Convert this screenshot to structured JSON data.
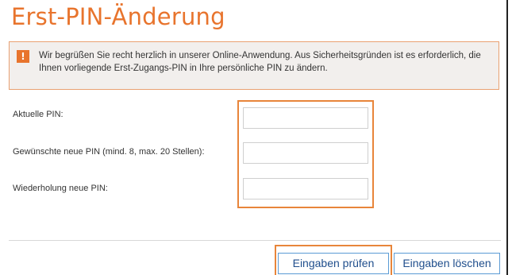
{
  "page": {
    "title": "Erst-PIN-Änderung"
  },
  "notice": {
    "icon": "warning-exclamation-icon",
    "icon_glyph": "!",
    "text": "Wir begrüßen Sie recht herzlich in unserer Online-Anwendung. Aus Sicherheitsgründen ist es erforderlich, die Ihnen vorliegende Erst-Zugangs-PIN in Ihre persönliche PIN zu ändern."
  },
  "form": {
    "current_pin_label": "Aktuelle PIN:",
    "new_pin_label": "Gewünschte neue PIN (mind. 8, max. 20 Stellen):",
    "repeat_pin_label": "Wiederholung neue PIN:",
    "current_pin_value": "",
    "new_pin_value": "",
    "repeat_pin_value": ""
  },
  "actions": {
    "check_label": "Eingaben prüfen",
    "clear_label": "Eingaben löschen"
  },
  "colors": {
    "accent": "#e8742d",
    "highlight": "#e8853a",
    "notice_background": "#f2efed",
    "button_border": "#5b9bd5",
    "button_text": "#1f4e8c"
  }
}
